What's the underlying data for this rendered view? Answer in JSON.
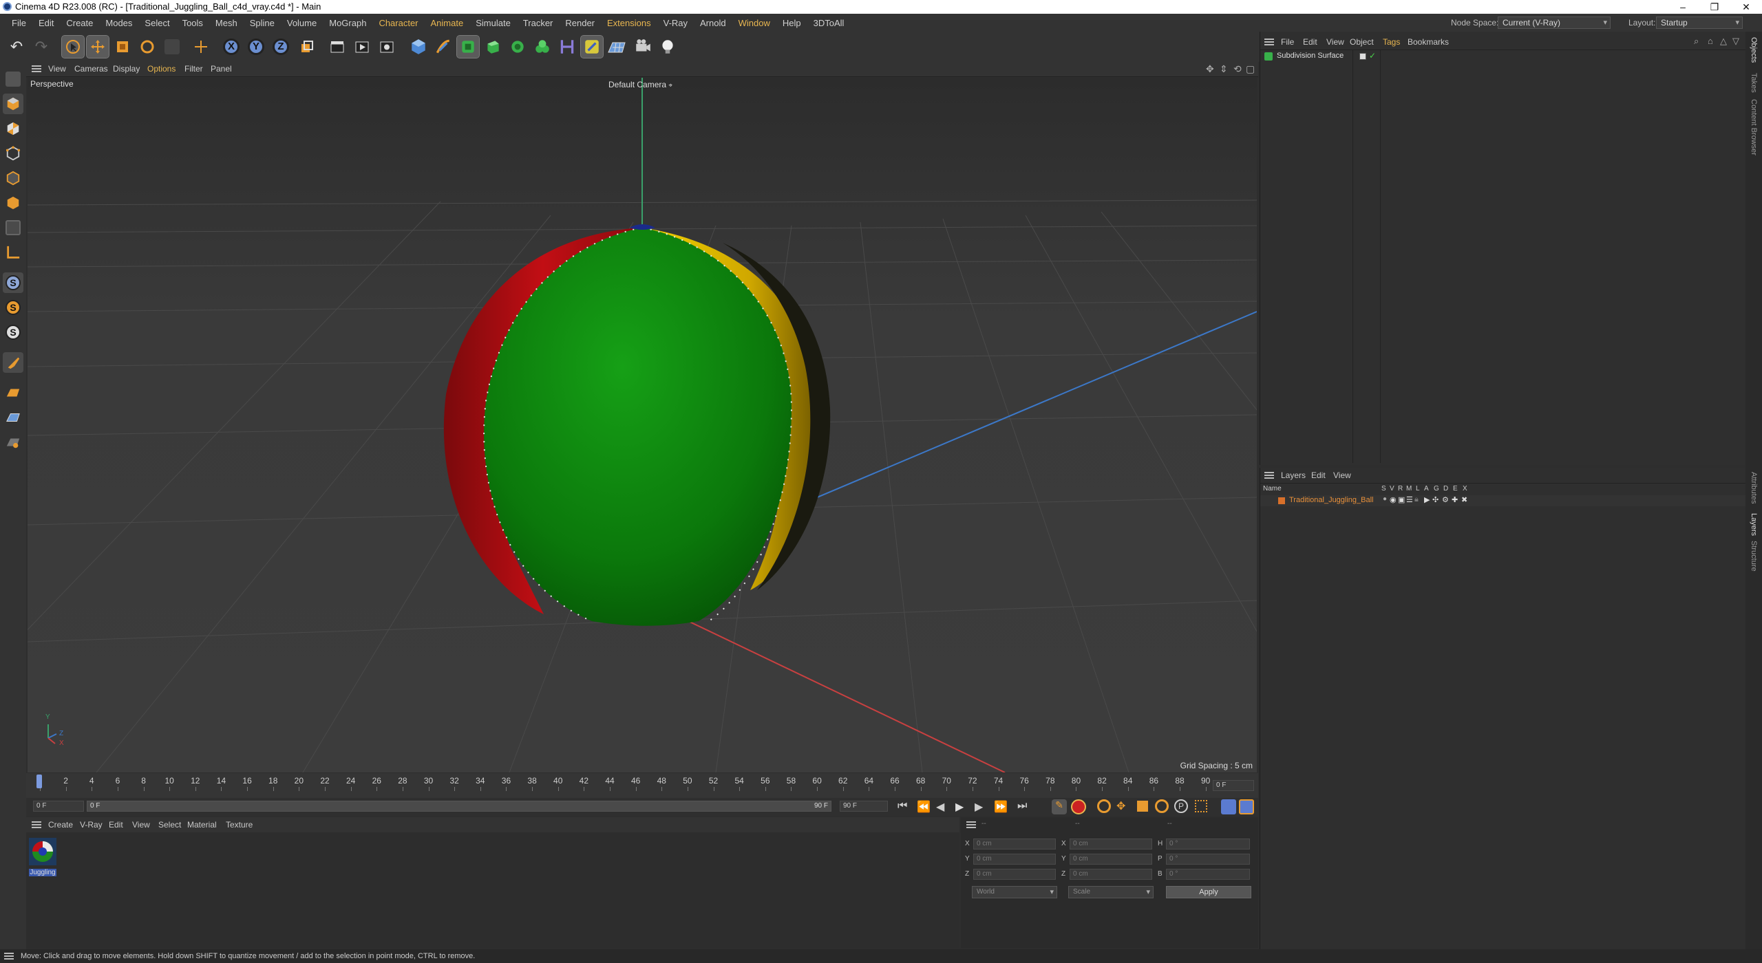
{
  "window": {
    "title": "Cinema 4D R23.008 (RC) - [Traditional_Juggling_Ball_c4d_vray.c4d *] - Main",
    "controls": [
      "–",
      "❐",
      "✕"
    ]
  },
  "menubar": {
    "items": [
      "File",
      "Edit",
      "Create",
      "Modes",
      "Select",
      "Tools",
      "Mesh",
      "Spline",
      "Volume",
      "MoGraph",
      "Character",
      "Animate",
      "Simulate",
      "Tracker",
      "Render",
      "Extensions",
      "V-Ray",
      "Arnold",
      "Window",
      "Help",
      "3DToAll"
    ],
    "node_space_label": "Node Space:",
    "node_space_value": "Current (V-Ray)",
    "layout_label": "Layout:",
    "layout_value": "Startup"
  },
  "toolbar": {
    "axis_x": "X",
    "axis_y": "Y",
    "axis_z": "Z"
  },
  "left_tools": {
    "s1": "S",
    "s2": "S",
    "s3": "S"
  },
  "viewport": {
    "menu": [
      "View",
      "Cameras",
      "Display",
      "Options",
      "Filter",
      "Panel"
    ],
    "name": "Perspective",
    "camera": "Default Camera",
    "camera_icon": "camera-target-icon",
    "grid_spacing": "Grid Spacing : 5 cm",
    "axis_labels": {
      "y": "Y",
      "z": "Z",
      "x": "X"
    }
  },
  "timeline": {
    "ticks": [
      "0",
      "2",
      "4",
      "6",
      "8",
      "10",
      "12",
      "14",
      "16",
      "18",
      "20",
      "22",
      "24",
      "26",
      "28",
      "30",
      "32",
      "34",
      "36",
      "38",
      "40",
      "42",
      "44",
      "46",
      "48",
      "50",
      "52",
      "54",
      "56",
      "58",
      "60",
      "62",
      "64",
      "66",
      "68",
      "70",
      "72",
      "74",
      "76",
      "78",
      "80",
      "82",
      "84",
      "86",
      "88",
      "90"
    ],
    "current_frame": "0 F",
    "start": "0 F",
    "range_start": "0 F",
    "range_end": "90 F",
    "end": "90 F"
  },
  "material_panel": {
    "menu": [
      "Create",
      "V-Ray",
      "Edit",
      "View",
      "Select",
      "Material",
      "Texture"
    ],
    "materials": [
      {
        "name": "Juggling"
      }
    ]
  },
  "coord_panel": {
    "headers": [
      "--",
      "--",
      "--"
    ],
    "rows": [
      {
        "a": "X",
        "av": "0 cm",
        "b": "X",
        "bv": "0 cm",
        "c": "H",
        "cv": "0 °"
      },
      {
        "a": "Y",
        "av": "0 cm",
        "b": "Y",
        "bv": "0 cm",
        "c": "P",
        "cv": "0 °"
      },
      {
        "a": "Z",
        "av": "0 cm",
        "b": "Z",
        "bv": "0 cm",
        "c": "B",
        "cv": "0 °"
      }
    ],
    "mode1": "World",
    "mode2": "Scale",
    "apply": "Apply"
  },
  "object_panel": {
    "menu": [
      "File",
      "Edit",
      "View",
      "Object",
      "Tags",
      "Bookmarks"
    ],
    "objects": [
      {
        "name": "Subdivision Surface"
      }
    ]
  },
  "layer_panel": {
    "menu": [
      "Layers",
      "Edit",
      "View"
    ],
    "col_name": "Name",
    "cols": [
      "S",
      "V",
      "R",
      "M",
      "L",
      "A",
      "G",
      "D",
      "E",
      "X"
    ],
    "layers": [
      {
        "name": "Traditional_Juggling_Ball",
        "color": "#d8702a"
      }
    ]
  },
  "right_tabs": {
    "top": [
      "Objects",
      "Takes",
      "Content Browser"
    ],
    "bottom": [
      "Attributes",
      "Layers",
      "Structure"
    ]
  },
  "status": "Move: Click and drag to move elements. Hold down SHIFT to quantize movement / add to the selection in point mode, CTRL to remove.",
  "colors": {
    "accent": "#e8b650",
    "ball_green": "#0d7a0d",
    "ball_red": "#b80d12",
    "ball_yellow": "#e0b800",
    "axis_green": "#3aa06a",
    "axis_blue": "#3c78c8",
    "axis_red": "#c84040"
  }
}
